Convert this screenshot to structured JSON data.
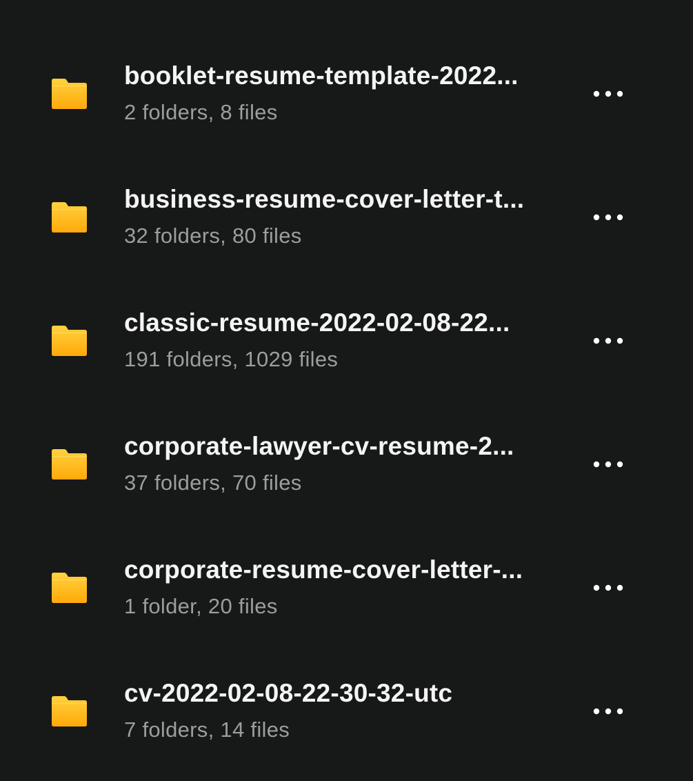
{
  "colors": {
    "background": "#171818",
    "folder_top": "#ffd23f",
    "folder_bottom": "#ffa90a",
    "title_text": "#f4f4f4",
    "meta_text": "#9d9d9d",
    "dots": "#ffffff"
  },
  "icons": {
    "item_icon": "folder-icon",
    "more_icon": "more-horizontal-icon"
  },
  "items": [
    {
      "name": "booklet-resume-template-2022...",
      "meta": "2 folders, 8 files"
    },
    {
      "name": "business-resume-cover-letter-t...",
      "meta": "32 folders, 80 files"
    },
    {
      "name": "classic-resume-2022-02-08-22...",
      "meta": "191 folders, 1029 files"
    },
    {
      "name": "corporate-lawyer-cv-resume-2...",
      "meta": "37 folders, 70 files"
    },
    {
      "name": "corporate-resume-cover-letter-...",
      "meta": "1 folder, 20 files"
    },
    {
      "name": "cv-2022-02-08-22-30-32-utc",
      "meta": "7 folders, 14 files"
    }
  ]
}
